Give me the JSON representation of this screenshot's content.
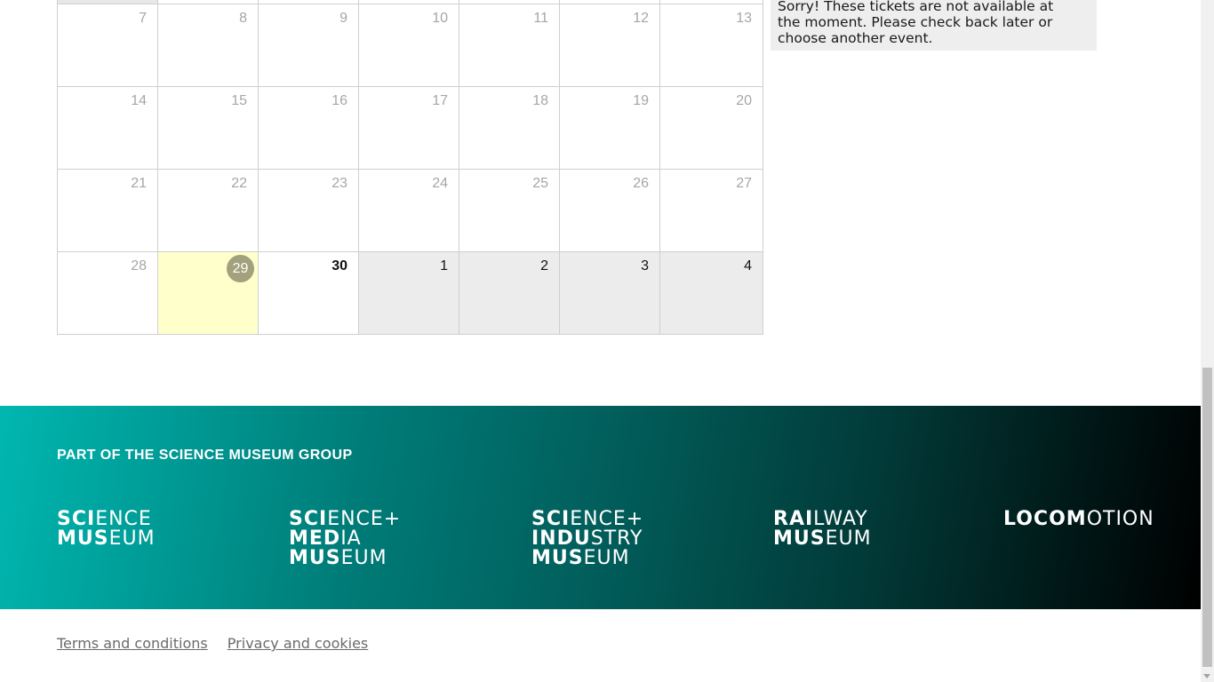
{
  "calendar": {
    "weeks": [
      [
        {
          "label": ""
        },
        {
          "label": ""
        },
        {
          "label": ""
        },
        {
          "label": ""
        },
        {
          "label": ""
        },
        {
          "label": ""
        },
        {
          "label": ""
        }
      ],
      [
        {
          "label": "7",
          "state": "past"
        },
        {
          "label": "8",
          "state": "past"
        },
        {
          "label": "9",
          "state": "past"
        },
        {
          "label": "10",
          "state": "past"
        },
        {
          "label": "11",
          "state": "past"
        },
        {
          "label": "12",
          "state": "past"
        },
        {
          "label": "13",
          "state": "past"
        }
      ],
      [
        {
          "label": "14",
          "state": "past"
        },
        {
          "label": "15",
          "state": "past"
        },
        {
          "label": "16",
          "state": "past"
        },
        {
          "label": "17",
          "state": "past"
        },
        {
          "label": "18",
          "state": "past"
        },
        {
          "label": "19",
          "state": "past"
        },
        {
          "label": "20",
          "state": "past"
        }
      ],
      [
        {
          "label": "21",
          "state": "past"
        },
        {
          "label": "22",
          "state": "past"
        },
        {
          "label": "23",
          "state": "past"
        },
        {
          "label": "24",
          "state": "past"
        },
        {
          "label": "25",
          "state": "past"
        },
        {
          "label": "26",
          "state": "past"
        },
        {
          "label": "27",
          "state": "past"
        }
      ],
      [
        {
          "label": "28",
          "state": "past"
        },
        {
          "label": "29",
          "state": "selected"
        },
        {
          "label": "30",
          "state": "today"
        },
        {
          "label": "1",
          "state": "future"
        },
        {
          "label": "2",
          "state": "future"
        },
        {
          "label": "3",
          "state": "future"
        },
        {
          "label": "4",
          "state": "future"
        }
      ]
    ]
  },
  "notice": {
    "line1": "Sorry! These tickets are not available at",
    "line2": "the moment. Please check back later or",
    "line3": "choose another event."
  },
  "footer": {
    "group_title": "PART OF THE SCIENCE MUSEUM GROUP",
    "logos": {
      "science_museum": {
        "l1_bold": "SCI",
        "l1_light": "ENCE",
        "l2_bold": "MUS",
        "l2_light": "EUM"
      },
      "media_museum": {
        "l1_bold": "SCI",
        "l1_light": "ENCE+",
        "l2_bold": "MED",
        "l2_light": "IA",
        "l3_bold": "MUS",
        "l3_light": "EUM"
      },
      "industry_museum": {
        "l1_bold": "SCI",
        "l1_light": "ENCE+",
        "l2_bold": "INDU",
        "l2_light": "STRY",
        "l3_bold": "MUS",
        "l3_light": "EUM"
      },
      "railway_museum": {
        "l1_bold": "RAI",
        "l1_light": "LWAY",
        "l2_bold": "MUS",
        "l2_light": "EUM"
      },
      "locomotion": {
        "l1_bold": "LOCOM",
        "l1_light": "OTION"
      }
    }
  },
  "links": {
    "terms": "Terms and conditions",
    "privacy": "Privacy and cookies"
  },
  "colors": {
    "selected_bg": "#ffffcc",
    "selected_badge": "#a1a17b",
    "future_bg": "#ececec",
    "footer_gradient_start": "#00b7b0",
    "footer_gradient_end": "#000000"
  }
}
